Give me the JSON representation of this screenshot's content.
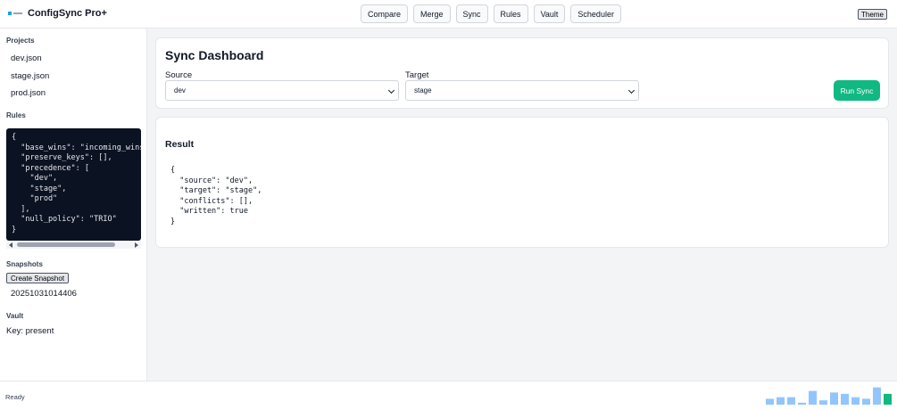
{
  "app": {
    "title": "ConfigSync Pro+"
  },
  "nav": [
    "Compare",
    "Merge",
    "Sync",
    "Rules",
    "Vault",
    "Scheduler"
  ],
  "header": {
    "theme_label": "Theme"
  },
  "sidebar": {
    "projects_heading": "Projects",
    "projects": [
      "dev.json",
      "stage.json",
      "prod.json"
    ],
    "rules_heading": "Rules",
    "rules_code": "{\n  \"base_wins\": \"incoming_wins\",\n  \"preserve_keys\": [],\n  \"precedence\": [\n    \"dev\",\n    \"stage\",\n    \"prod\"\n  ],\n  \"null_policy\": \"TRIO\"\n}",
    "snapshots_heading": "Snapshots",
    "snapshot_button": "Create Snapshot",
    "snapshot_id": "20251031014406",
    "vault_heading": "Vault",
    "vault_status": "Key: present"
  },
  "dashboard": {
    "title": "Sync Dashboard",
    "source_label": "Source",
    "source_value": "dev",
    "target_label": "Target",
    "target_value": "stage",
    "run_button": "Run Sync"
  },
  "result": {
    "title": "Result",
    "code": "{\n  \"source\": \"dev\",\n  \"target\": \"stage\",\n  \"conflicts\": [],\n  \"written\": true\n}"
  },
  "footer": {
    "status": "Ready"
  },
  "colors": {
    "accent": "#10b981",
    "bars": "#93c5fd",
    "code_bg": "#0b1222"
  },
  "activity_bars": [
    0.3,
    0.38,
    0.38,
    0.1,
    0.7,
    0.22,
    0.62,
    0.55,
    0.38,
    0.3,
    0.88,
    0.55
  ],
  "activity_highlight_index": 11
}
